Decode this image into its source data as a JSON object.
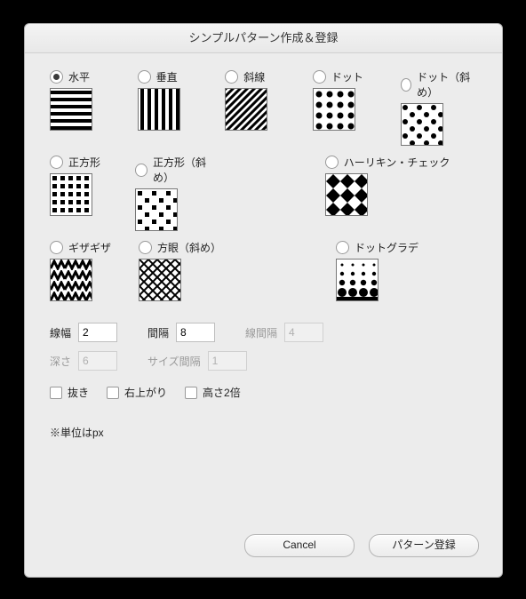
{
  "title": "シンプルパターン作成＆登録",
  "patterns": {
    "horizontal": "水平",
    "vertical": "垂直",
    "diagonal": "斜線",
    "dot": "ドット",
    "dot_diag": "ドット（斜め）",
    "square": "正方形",
    "square_diag": "正方形（斜め）",
    "harlequin": "ハーリキン・チェック",
    "zigzag": "ギザギザ",
    "grid_diag": "方眼（斜め）",
    "dot_grad": "ドットグラデ"
  },
  "selected": "horizontal",
  "fields": {
    "line_width": {
      "label": "線幅",
      "value": "2",
      "enabled": true
    },
    "gap": {
      "label": "間隔",
      "value": "8",
      "enabled": true
    },
    "line_gap": {
      "label": "線間隔",
      "value": "4",
      "enabled": false
    },
    "depth": {
      "label": "深さ",
      "value": "6",
      "enabled": false
    },
    "size_gap": {
      "label": "サイズ間隔",
      "value": "1",
      "enabled": false
    }
  },
  "checks": {
    "nuki": "抜き",
    "migi_agari": "右上がり",
    "takasa_2bai": "高さ2倍"
  },
  "note": "※単位はpx",
  "buttons": {
    "cancel": "Cancel",
    "register": "パターン登録"
  }
}
